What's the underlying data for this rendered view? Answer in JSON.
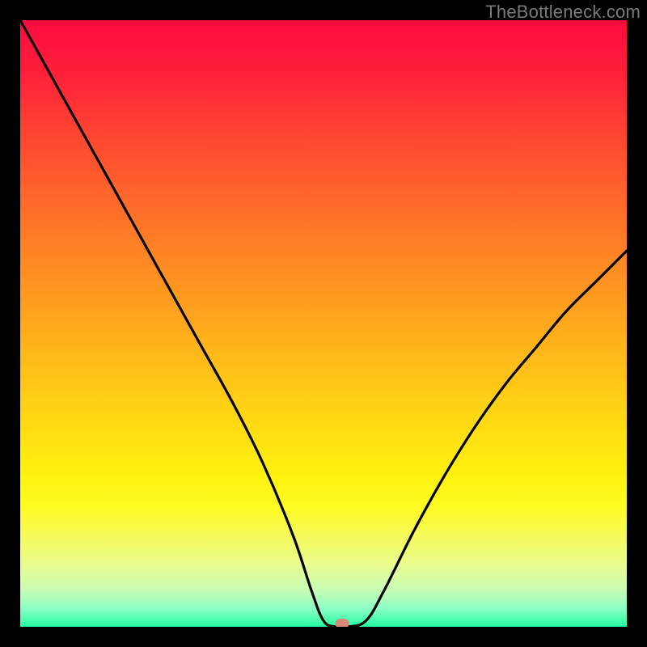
{
  "watermark": "TheBottleneck.com",
  "chart_data": {
    "type": "line",
    "title": "",
    "xlabel": "",
    "ylabel": "",
    "xlim": [
      0,
      100
    ],
    "ylim": [
      0,
      100
    ],
    "grid": false,
    "legend": false,
    "background_gradient": {
      "top": "#ff0b3f",
      "mid": "#ffd913",
      "bottom": "#23ff9f"
    },
    "series": [
      {
        "name": "bottleneck-curve",
        "color": "#000000",
        "x": [
          0,
          5,
          10,
          15,
          20,
          25,
          30,
          35,
          40,
          45,
          48,
          50,
          52,
          54,
          57,
          60,
          65,
          70,
          75,
          80,
          85,
          90,
          95,
          100
        ],
        "y": [
          100,
          91,
          82,
          73,
          64,
          55,
          46,
          37,
          27,
          15,
          6,
          1,
          0,
          0,
          1,
          6,
          16,
          25,
          33,
          40,
          46,
          52,
          57,
          62
        ]
      }
    ],
    "marker": {
      "name": "optimal-point",
      "x": 53,
      "y": 0.5,
      "color": "#d98877"
    }
  }
}
